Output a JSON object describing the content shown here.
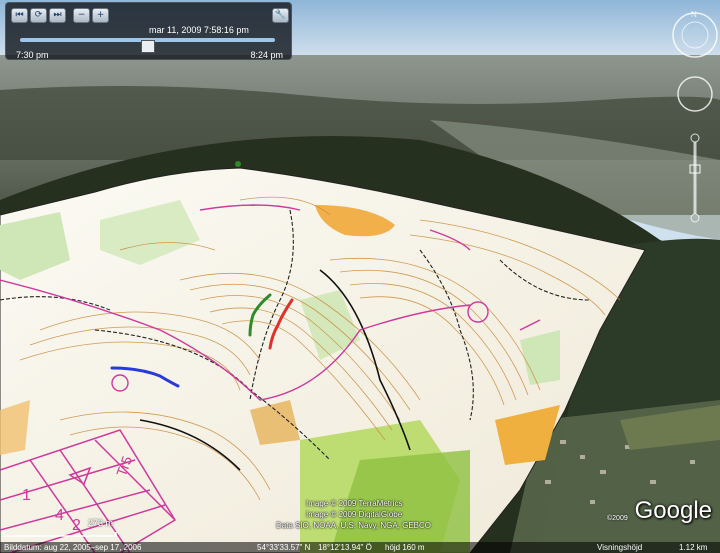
{
  "timeslider": {
    "date_label": "mar 11, 2009   7:58:16 pm",
    "start_label": "7:30 pm",
    "end_label": "8:24 pm",
    "buttons": [
      {
        "icon": "skip-back-icon",
        "glyph": "⏮"
      },
      {
        "icon": "play-icon",
        "glyph": "⟳"
      },
      {
        "icon": "skip-forward-icon",
        "glyph": "⏭"
      },
      {
        "icon": "zoom-out-time-icon",
        "glyph": "−"
      },
      {
        "icon": "zoom-in-time-icon",
        "glyph": "+"
      }
    ],
    "settings_icon": "wrench-icon",
    "handle_label": "lılı"
  },
  "map_labels": {
    "scale": "273 m",
    "course_labels": [
      "Tr5",
      "1",
      "4",
      "2"
    ]
  },
  "credits": {
    "line1": "Image © 2009 TerraMetrics",
    "line2": "Image © 2009 DigitalGlobe",
    "line3": "Data SIO, NOAA, U.S. Navy, NGA, GEBCO"
  },
  "logo": {
    "brand": "Google",
    "copyright": "©2009"
  },
  "statusbar": {
    "imagery_date": "Bilddatum: aug 22, 2005–sep 17, 2006",
    "lat": "54°33'33.57\" N",
    "lon": "18°12'13.94\" Ö",
    "elevation": "höjd 160 m",
    "eye_altitude_label": "Visningshöjd",
    "eye_altitude": "1.12 km"
  },
  "colors": {
    "sky": "#cfe0ee",
    "forest": "#2c3624",
    "map_paper": "#f5f3ea",
    "contour": "#c98a3a",
    "course_magenta": "#d0389c",
    "route_red": "#e0302a",
    "route_green": "#2f8a2a",
    "route_blue": "#2a3ad8"
  }
}
